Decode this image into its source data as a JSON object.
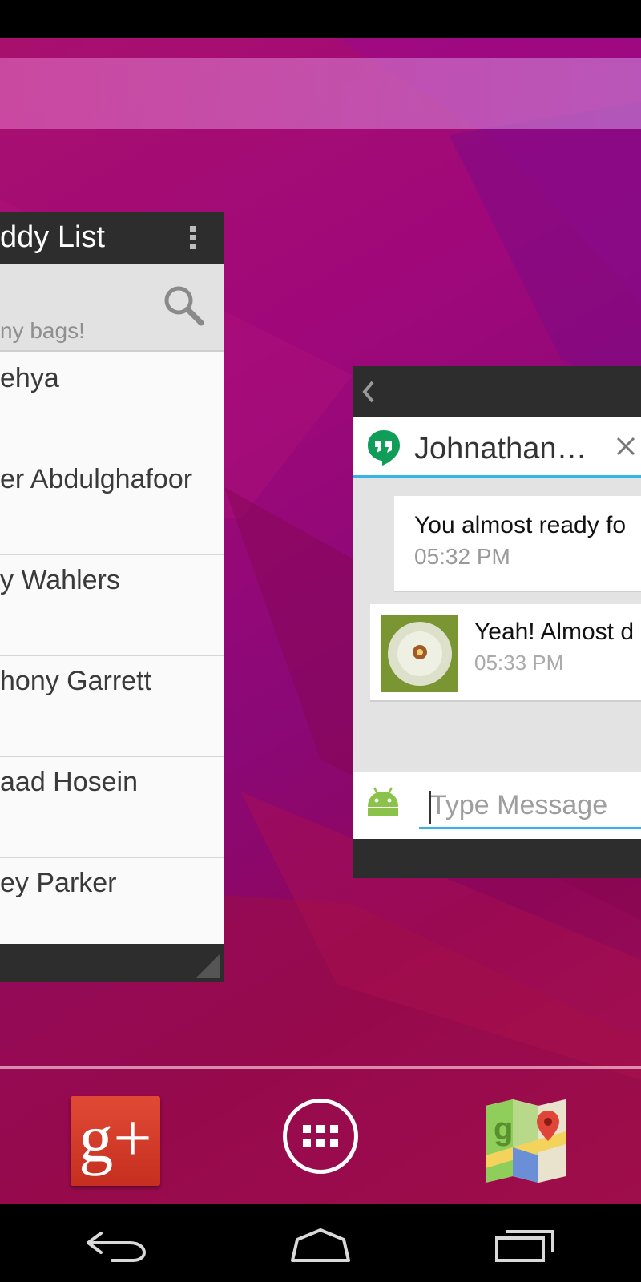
{
  "buddy_list": {
    "title": "ddy List",
    "status_text": "ny bags!",
    "contacts": [
      "ehya",
      "er Abdulghafoor",
      "y Wahlers",
      "hony Garrett",
      "aad Hosein",
      "ey Parker"
    ]
  },
  "chat": {
    "contact_name": "Johnathan…",
    "messages": [
      {
        "text": "You almost ready fo",
        "time": "05:32 PM"
      },
      {
        "text": "Yeah! Almost d",
        "time": "05:33 PM"
      }
    ],
    "input_placeholder": "Type Message"
  },
  "dock": {
    "apps": [
      {
        "icon": "google-plus-icon",
        "label": "g+"
      },
      {
        "icon": "app-drawer-icon"
      },
      {
        "icon": "maps-icon"
      }
    ]
  },
  "nav_bar": {
    "buttons": [
      "back-icon",
      "home-icon",
      "recents-icon"
    ]
  },
  "colors": {
    "accent": "#33b5e5",
    "hangouts_green": "#0f9d58",
    "widget_dark": "#2d2d2d",
    "gplus_red": "#d73d32"
  }
}
